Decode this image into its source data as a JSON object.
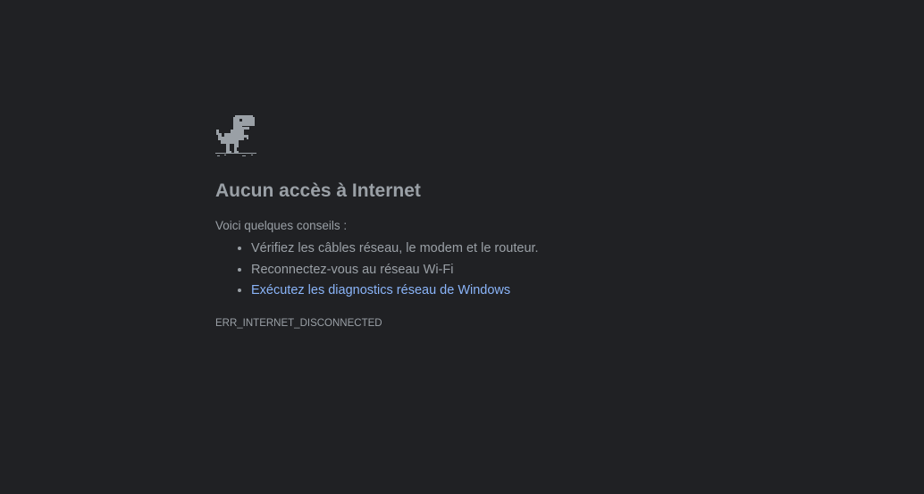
{
  "error_page": {
    "icon": "offline-dinosaur-icon",
    "title": "Aucun accès à Internet",
    "tips_intro": "Voici quelques conseils :",
    "tips": [
      "Vérifiez les câbles réseau, le modem et le routeur.",
      "Reconnectez-vous au réseau Wi-Fi"
    ],
    "diagnostics_link": "Exécutez les diagnostics réseau de Windows",
    "error_code": "ERR_INTERNET_DISCONNECTED"
  },
  "colors": {
    "background": "#202124",
    "text": "#9aa0a6",
    "link": "#8ab4f8"
  }
}
